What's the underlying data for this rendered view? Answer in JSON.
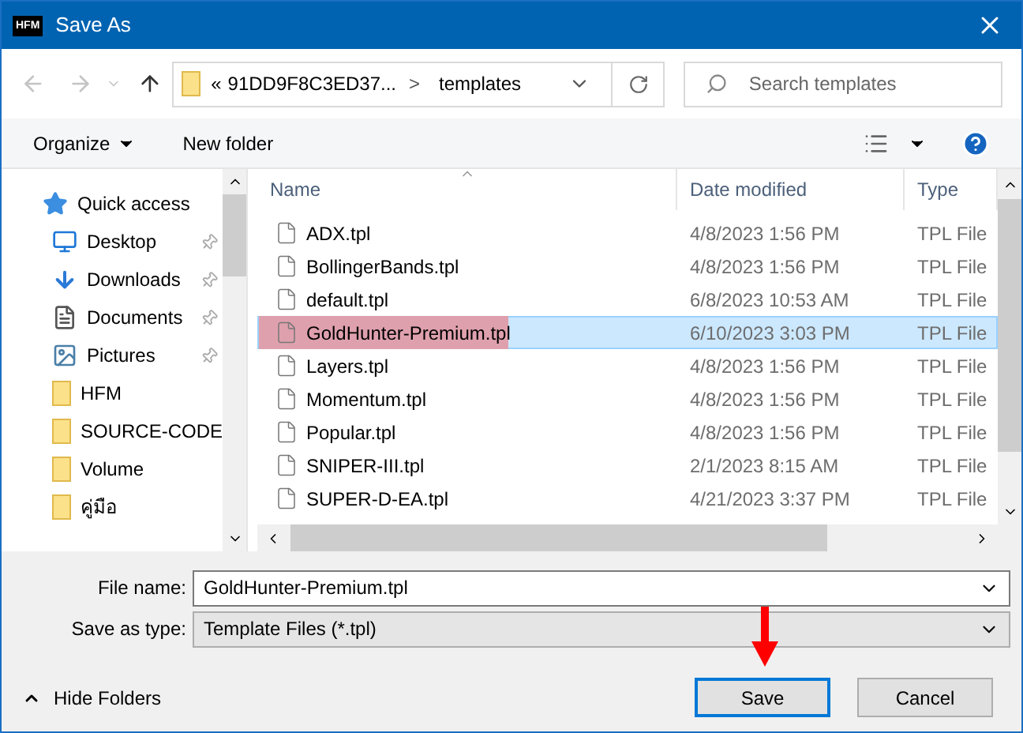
{
  "window": {
    "title": "Save As",
    "logo": "HFM"
  },
  "address_bar": {
    "overflow": "«",
    "segments": [
      "91DD9F8C3ED37...",
      "templates"
    ],
    "separator": ">"
  },
  "search": {
    "placeholder": "Search templates"
  },
  "toolbar": {
    "items": [
      "Organize",
      "New folder"
    ]
  },
  "sidebar": {
    "items": [
      {
        "label": "Quick access",
        "kind": "star",
        "pinned": false
      },
      {
        "label": "Desktop",
        "kind": "desktop",
        "pinned": true
      },
      {
        "label": "Downloads",
        "kind": "download",
        "pinned": true
      },
      {
        "label": "Documents",
        "kind": "document",
        "pinned": true
      },
      {
        "label": "Pictures",
        "kind": "picture",
        "pinned": true
      },
      {
        "label": "HFM",
        "kind": "folder",
        "pinned": false
      },
      {
        "label": "SOURCE-CODE",
        "kind": "folder",
        "pinned": false
      },
      {
        "label": "Volume",
        "kind": "folder",
        "pinned": false
      },
      {
        "label": "คู่มือ",
        "kind": "folder",
        "pinned": false
      }
    ]
  },
  "table": {
    "columns": [
      "Name",
      "Date modified",
      "Type"
    ],
    "rows": [
      {
        "name": "ADX.tpl",
        "date": "4/8/2023 1:56 PM",
        "type": "TPL File",
        "selected": false,
        "highlighted": false
      },
      {
        "name": "BollingerBands.tpl",
        "date": "4/8/2023 1:56 PM",
        "type": "TPL File",
        "selected": false,
        "highlighted": false
      },
      {
        "name": "default.tpl",
        "date": "6/8/2023 10:53 AM",
        "type": "TPL File",
        "selected": false,
        "highlighted": false
      },
      {
        "name": "GoldHunter-Premium.tpl",
        "date": "6/10/2023 3:03 PM",
        "type": "TPL File",
        "selected": true,
        "highlighted": true
      },
      {
        "name": "Layers.tpl",
        "date": "4/8/2023 1:56 PM",
        "type": "TPL File",
        "selected": false,
        "highlighted": false
      },
      {
        "name": "Momentum.tpl",
        "date": "4/8/2023 1:56 PM",
        "type": "TPL File",
        "selected": false,
        "highlighted": false
      },
      {
        "name": "Popular.tpl",
        "date": "4/8/2023 1:56 PM",
        "type": "TPL File",
        "selected": false,
        "highlighted": false
      },
      {
        "name": "SNIPER-III.tpl",
        "date": "2/1/2023 8:15 AM",
        "type": "TPL File",
        "selected": false,
        "highlighted": false
      },
      {
        "name": "SUPER-D-EA.tpl",
        "date": "4/21/2023 3:37 PM",
        "type": "TPL File",
        "selected": false,
        "highlighted": false
      }
    ]
  },
  "file_name": {
    "label": "File name:",
    "value": "GoldHunter-Premium.tpl"
  },
  "save_as_type": {
    "label": "Save as type:",
    "value": "Template Files (*.tpl)"
  },
  "hide_folders": {
    "label": "Hide Folders"
  },
  "buttons": [
    {
      "label": "Save",
      "default": true
    },
    {
      "label": "Cancel",
      "default": false
    }
  ]
}
